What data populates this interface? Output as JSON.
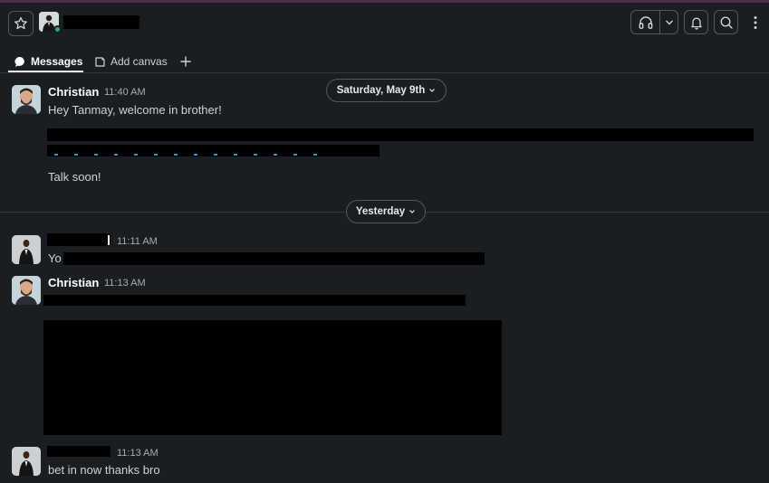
{
  "header": {
    "star_icon": "star-icon",
    "huddle_icon": "headphones-icon",
    "huddle_menu_icon": "chevron-down-icon",
    "notifications_icon": "bell-icon",
    "search_icon": "search-icon",
    "more_icon": "kebab-icon"
  },
  "tabs": [
    {
      "label": "Messages",
      "icon": "message-bubble-icon",
      "active": true
    },
    {
      "label": "Add canvas",
      "icon": "canvas-icon",
      "active": false
    }
  ],
  "add_tab_icon": "plus-icon",
  "dates": {
    "first": "Saturday, May 9th",
    "second": "Yesterday"
  },
  "messages": [
    {
      "author": "Christian",
      "time": "11:40 AM",
      "text": "Hey Tanmay, welcome in brother!",
      "text2": "Talk soon!"
    },
    {
      "author": "",
      "time": "11:11 AM",
      "text": "Yo"
    },
    {
      "author": "Christian",
      "time": "11:13 AM",
      "text": ""
    },
    {
      "author": "",
      "time": "11:13 AM",
      "text": "bet in now thanks bro"
    }
  ],
  "colors": {
    "background": "#1a1d21",
    "border": "#565856",
    "presence": "#2bac76",
    "link": "#1d9bd1"
  }
}
